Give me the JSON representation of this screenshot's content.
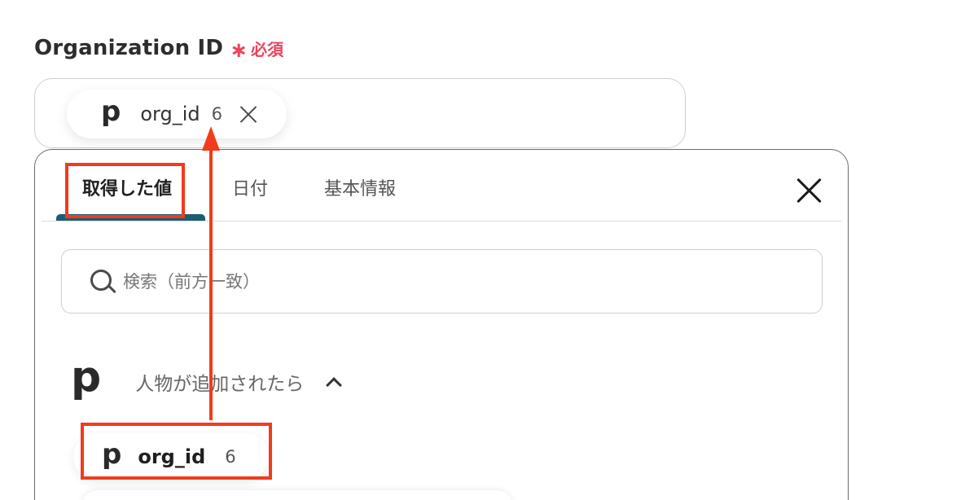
{
  "field": {
    "label": "Organization ID",
    "required_mark": "∗",
    "required_text": "必須"
  },
  "selected_chip": {
    "icon": "p",
    "label": "org_id",
    "count": "6"
  },
  "tabs": [
    {
      "label": "取得した値",
      "active": true
    },
    {
      "label": "日付",
      "active": false
    },
    {
      "label": "基本情報",
      "active": false
    }
  ],
  "search": {
    "placeholder": "検索（前方一致）"
  },
  "group": {
    "icon": "p",
    "title": "人物が追加されたら"
  },
  "option_chip": {
    "icon": "p",
    "label": "org_id",
    "count": "6"
  },
  "colors": {
    "required": "#e8455c",
    "accent_tab": "#1e5c73",
    "annotation": "#f23b1c"
  }
}
